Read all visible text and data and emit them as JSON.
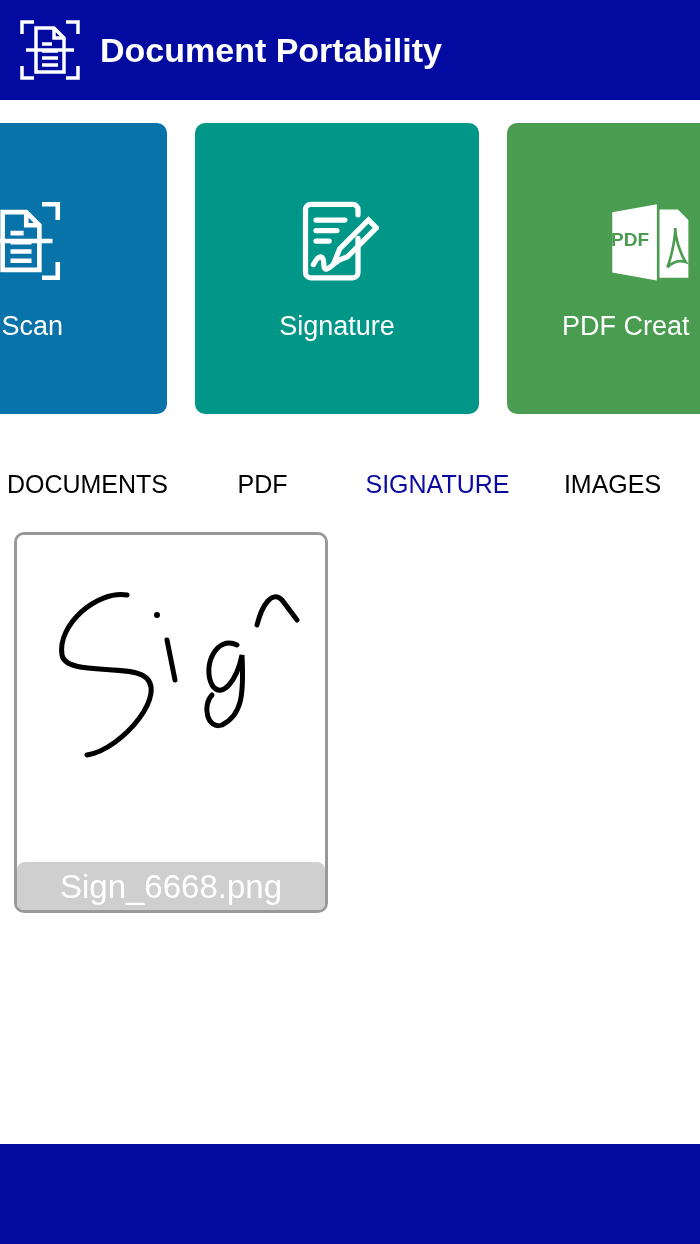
{
  "header": {
    "title": "Document Portability"
  },
  "feature_cards": [
    {
      "kind": "scan",
      "label": "Scan",
      "color": "#0873a8"
    },
    {
      "kind": "signature",
      "label": "Signature",
      "color": "#009688"
    },
    {
      "kind": "pdf",
      "label": "PDF Creat",
      "icon_text": "PDF",
      "color": "#4a9c50"
    }
  ],
  "tabs": [
    {
      "label": "DOCUMENTS",
      "selected": false
    },
    {
      "label": "PDF",
      "selected": false
    },
    {
      "label": "SIGNATURE",
      "selected": true
    },
    {
      "label": "IMAGES",
      "selected": false
    }
  ],
  "files": [
    {
      "kind": "picture",
      "name": "Sign_6668.png"
    }
  ]
}
